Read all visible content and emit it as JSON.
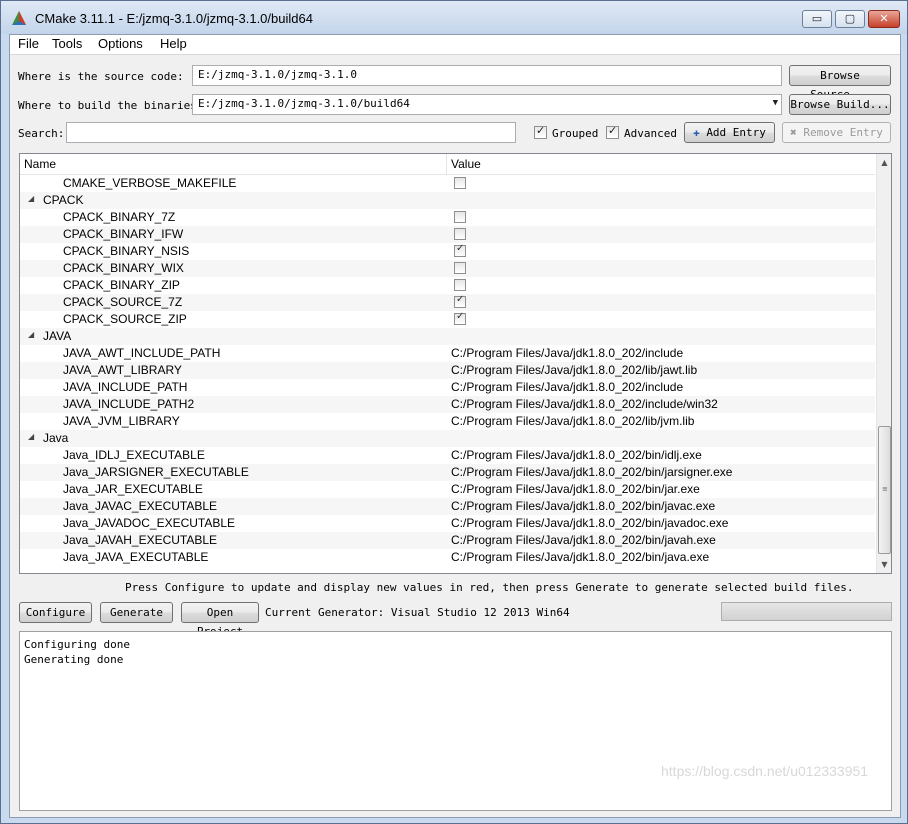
{
  "window": {
    "title": "CMake 3.11.1 - E:/jzmq-3.1.0/jzmq-3.1.0/build64"
  },
  "title_buttons": {
    "minimize": "▭",
    "maximize": "▢",
    "close": "✕"
  },
  "menu": [
    {
      "label": "File"
    },
    {
      "label": "Tools"
    },
    {
      "label": "Options"
    },
    {
      "label": "Help"
    }
  ],
  "source": {
    "label": "Where is the source code:",
    "value": "E:/jzmq-3.1.0/jzmq-3.1.0",
    "browse_label": "Browse Source..."
  },
  "build": {
    "label": "Where to build the binaries:",
    "value": "E:/jzmq-3.1.0/jzmq-3.1.0/build64",
    "browse_label": "Browse Build..."
  },
  "search": {
    "label": "Search:",
    "value": "",
    "grouped_label": "Grouped",
    "grouped_checked": true,
    "advanced_label": "Advanced",
    "advanced_checked": true,
    "add_entry_label": "Add Entry",
    "remove_entry_label": "Remove Entry"
  },
  "table": {
    "columns": [
      "Name",
      "Value"
    ],
    "rows": [
      {
        "type": "entry",
        "name": "CMAKE_VERBOSE_MAKEFILE",
        "checkbox": true,
        "checked": false
      },
      {
        "type": "group",
        "name": "CPACK"
      },
      {
        "type": "entry",
        "name": "CPACK_BINARY_7Z",
        "checkbox": true,
        "checked": false
      },
      {
        "type": "entry",
        "name": "CPACK_BINARY_IFW",
        "checkbox": true,
        "checked": false
      },
      {
        "type": "entry",
        "name": "CPACK_BINARY_NSIS",
        "checkbox": true,
        "checked": true
      },
      {
        "type": "entry",
        "name": "CPACK_BINARY_WIX",
        "checkbox": true,
        "checked": false
      },
      {
        "type": "entry",
        "name": "CPACK_BINARY_ZIP",
        "checkbox": true,
        "checked": false
      },
      {
        "type": "entry",
        "name": "CPACK_SOURCE_7Z",
        "checkbox": true,
        "checked": true
      },
      {
        "type": "entry",
        "name": "CPACK_SOURCE_ZIP",
        "checkbox": true,
        "checked": true
      },
      {
        "type": "group",
        "name": "JAVA"
      },
      {
        "type": "entry",
        "name": "JAVA_AWT_INCLUDE_PATH",
        "value": "C:/Program Files/Java/jdk1.8.0_202/include"
      },
      {
        "type": "entry",
        "name": "JAVA_AWT_LIBRARY",
        "value": "C:/Program Files/Java/jdk1.8.0_202/lib/jawt.lib"
      },
      {
        "type": "entry",
        "name": "JAVA_INCLUDE_PATH",
        "value": "C:/Program Files/Java/jdk1.8.0_202/include"
      },
      {
        "type": "entry",
        "name": "JAVA_INCLUDE_PATH2",
        "value": "C:/Program Files/Java/jdk1.8.0_202/include/win32"
      },
      {
        "type": "entry",
        "name": "JAVA_JVM_LIBRARY",
        "value": "C:/Program Files/Java/jdk1.8.0_202/lib/jvm.lib"
      },
      {
        "type": "group",
        "name": "Java"
      },
      {
        "type": "entry",
        "name": "Java_IDLJ_EXECUTABLE",
        "value": "C:/Program Files/Java/jdk1.8.0_202/bin/idlj.exe"
      },
      {
        "type": "entry",
        "name": "Java_JARSIGNER_EXECUTABLE",
        "value": "C:/Program Files/Java/jdk1.8.0_202/bin/jarsigner.exe"
      },
      {
        "type": "entry",
        "name": "Java_JAR_EXECUTABLE",
        "value": "C:/Program Files/Java/jdk1.8.0_202/bin/jar.exe"
      },
      {
        "type": "entry",
        "name": "Java_JAVAC_EXECUTABLE",
        "value": "C:/Program Files/Java/jdk1.8.0_202/bin/javac.exe"
      },
      {
        "type": "entry",
        "name": "Java_JAVADOC_EXECUTABLE",
        "value": "C:/Program Files/Java/jdk1.8.0_202/bin/javadoc.exe"
      },
      {
        "type": "entry",
        "name": "Java_JAVAH_EXECUTABLE",
        "value": "C:/Program Files/Java/jdk1.8.0_202/bin/javah.exe"
      },
      {
        "type": "entry",
        "name": "Java_JAVA_EXECUTABLE",
        "value": "C:/Program Files/Java/jdk1.8.0_202/bin/java.exe"
      }
    ]
  },
  "hint": "Press Configure to update and display new values in red, then press Generate to generate selected build files.",
  "actions": {
    "configure_label": "Configure",
    "generate_label": "Generate",
    "open_project_label": "Open Project",
    "current_generator": "Current Generator: Visual Studio 12 2013 Win64"
  },
  "output_lines": [
    "Configuring done",
    "Generating done"
  ],
  "watermark": "https://blog.csdn.net/u012333951"
}
